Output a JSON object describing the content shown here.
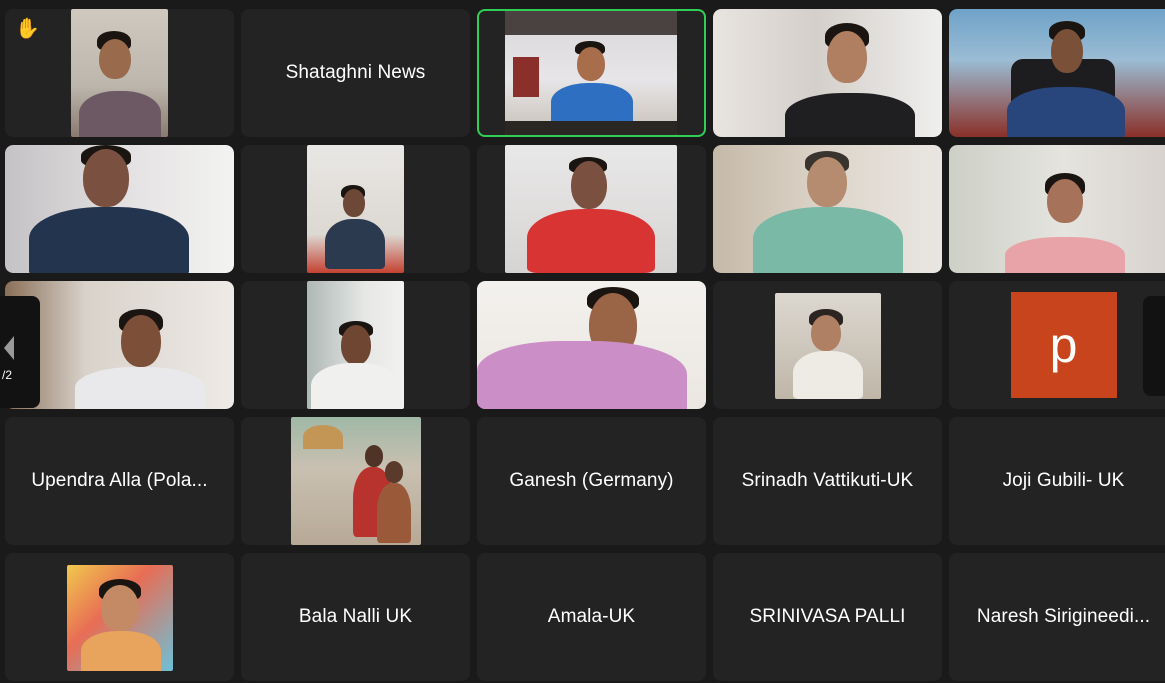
{
  "tiles": [
    {
      "name": "",
      "type": "video",
      "raised_hand": true
    },
    {
      "name": "Shataghni News",
      "type": "name"
    },
    {
      "name": "",
      "type": "video",
      "active": true
    },
    {
      "name": "",
      "type": "video"
    },
    {
      "name": "",
      "type": "video"
    },
    {
      "name": "",
      "type": "video"
    },
    {
      "name": "",
      "type": "video"
    },
    {
      "name": "",
      "type": "video"
    },
    {
      "name": "",
      "type": "video"
    },
    {
      "name": "",
      "type": "video"
    },
    {
      "name": "",
      "type": "video"
    },
    {
      "name": "",
      "type": "video"
    },
    {
      "name": "",
      "type": "video"
    },
    {
      "name": "",
      "type": "picture"
    },
    {
      "name": "",
      "type": "avatar",
      "avatar_letter": "p"
    },
    {
      "name": "Upendra Alla (Pola...",
      "type": "name"
    },
    {
      "name": "",
      "type": "picture"
    },
    {
      "name": "Ganesh (Germany)",
      "type": "name"
    },
    {
      "name": "Srinadh Vattikuti-UK",
      "type": "name"
    },
    {
      "name": "Joji Gubili- UK",
      "type": "name"
    },
    {
      "name": "",
      "type": "picture"
    },
    {
      "name": "Bala Nalli UK",
      "type": "name"
    },
    {
      "name": "Amala-UK",
      "type": "name"
    },
    {
      "name": "SRINIVASA PALLI",
      "type": "name"
    },
    {
      "name": "Naresh Sirigineedi...",
      "type": "name"
    }
  ],
  "pager": {
    "page_label": "/2"
  },
  "icons": {
    "raised_hand": "raised-hand-icon",
    "prev_page": "chevron-left-icon"
  },
  "colors": {
    "active_speaker": "#2fcf56",
    "tile_bg": "#232323",
    "avatar_bg": "#c8441c"
  }
}
